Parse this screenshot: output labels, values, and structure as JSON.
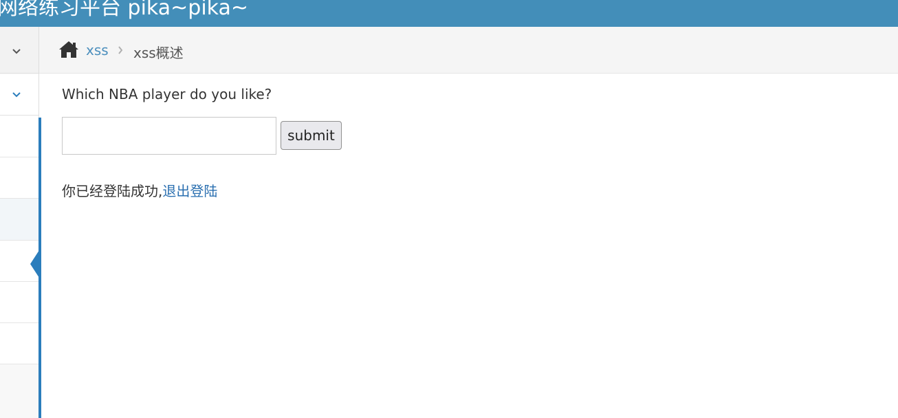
{
  "header": {
    "title": "网络练习平台 pika~pika~"
  },
  "breadcrumb": {
    "home_icon": "home-icon",
    "parent": "xss",
    "current": "xss概述"
  },
  "form": {
    "question": "Which NBA player do you like?",
    "input_value": "",
    "submit_label": "submit"
  },
  "status": {
    "message": "你已经登陆成功,",
    "logout_link": "退出登陆"
  },
  "colors": {
    "header": "#438eb9",
    "accent": "#2b7dbc",
    "link": "#4c8fbd"
  }
}
